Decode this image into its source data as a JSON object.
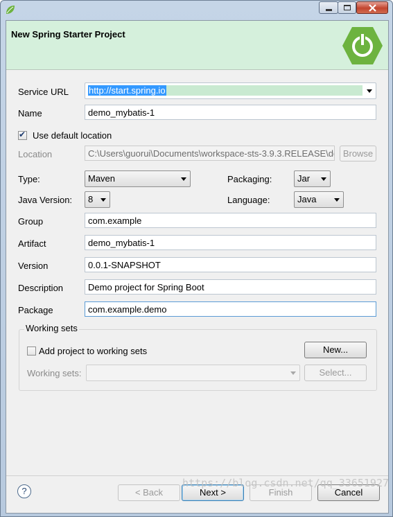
{
  "dialog": {
    "title": "New Spring Starter Project"
  },
  "form": {
    "service_url": {
      "label": "Service URL",
      "value": "http://start.spring.io"
    },
    "name": {
      "label": "Name",
      "value": "demo_mybatis-1"
    },
    "use_default_location": {
      "label": "Use default location",
      "checked": true
    },
    "location": {
      "label": "Location",
      "value": "C:\\Users\\guorui\\Documents\\workspace-sts-3.9.3.RELEASE\\de",
      "browse_label": "Browse"
    },
    "type": {
      "label": "Type:",
      "value": "Maven"
    },
    "packaging": {
      "label": "Packaging:",
      "value": "Jar"
    },
    "java_version": {
      "label": "Java Version:",
      "value": "8"
    },
    "language": {
      "label": "Language:",
      "value": "Java"
    },
    "group": {
      "label": "Group",
      "value": "com.example"
    },
    "artifact": {
      "label": "Artifact",
      "value": "demo_mybatis-1"
    },
    "version": {
      "label": "Version",
      "value": "0.0.1-SNAPSHOT"
    },
    "description": {
      "label": "Description",
      "value": "Demo project for Spring Boot"
    },
    "package": {
      "label": "Package",
      "value": "com.example.demo"
    }
  },
  "working_sets": {
    "title": "Working sets",
    "add_label": "Add project to working sets",
    "new_label": "New...",
    "sets_label": "Working sets:",
    "select_label": "Select..."
  },
  "footer": {
    "back_label": "< Back",
    "next_label": "Next >",
    "finish_label": "Finish",
    "cancel_label": "Cancel"
  },
  "watermark": "https://blog.csdn.net/qq_33651927",
  "colors": {
    "header_bg": "#d5f0dc",
    "spring_green": "#6db33f",
    "selection": "#3399ff"
  }
}
